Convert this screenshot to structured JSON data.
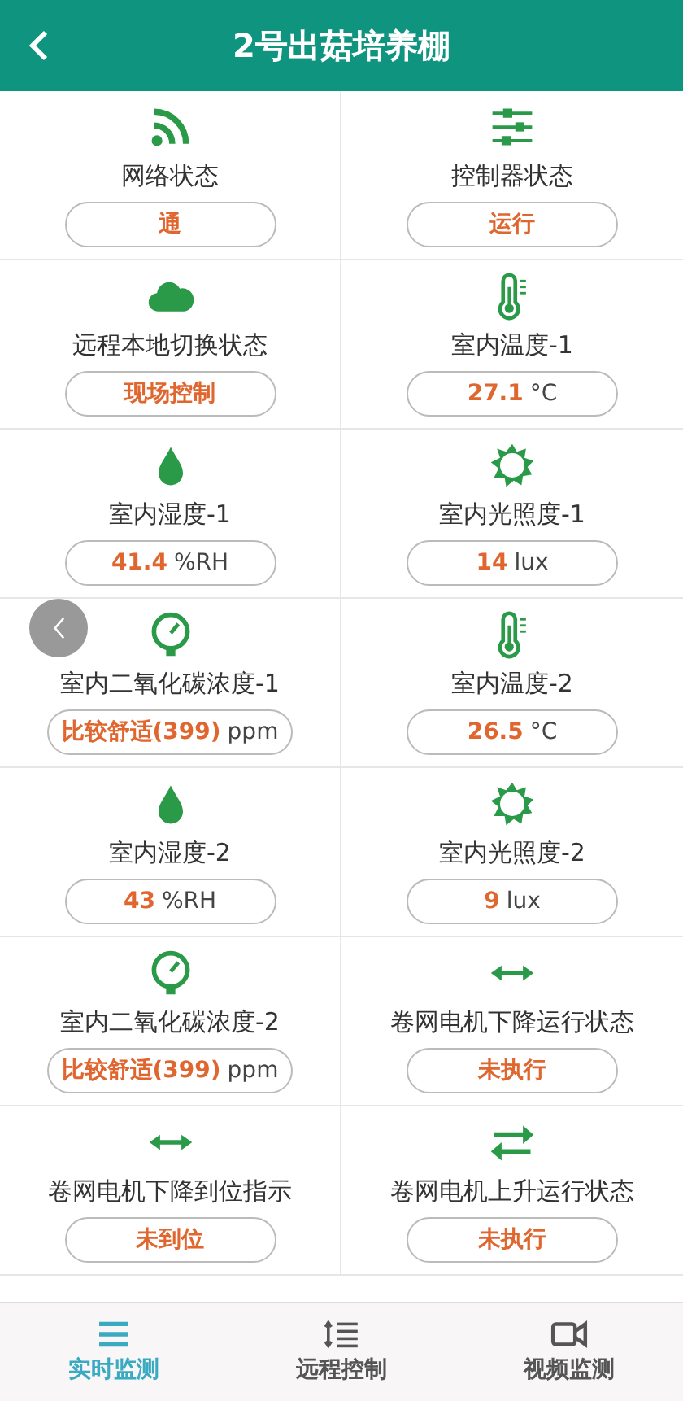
{
  "header": {
    "title": "2号出菇培养棚"
  },
  "sensors": [
    {
      "kind": "wifi",
      "label": "网络状态",
      "value": "通"
    },
    {
      "kind": "sliders",
      "label": "控制器状态",
      "value": "运行"
    },
    {
      "kind": "cloud",
      "label": "远程本地切换状态",
      "value": "现场控制"
    },
    {
      "kind": "thermometer",
      "label": "室内温度-1",
      "value": "27.1",
      "unit": "°C"
    },
    {
      "kind": "drop",
      "label": "室内湿度-1",
      "value": "41.4",
      "unit": "%RH"
    },
    {
      "kind": "sun",
      "label": "室内光照度-1",
      "value": "14",
      "unit": "lux"
    },
    {
      "kind": "gauge",
      "label": "室内二氧化碳浓度-1",
      "value": "比较舒适(399)",
      "unit": "ppm"
    },
    {
      "kind": "thermometer",
      "label": "室内温度-2",
      "value": "26.5",
      "unit": "°C"
    },
    {
      "kind": "drop",
      "label": "室内湿度-2",
      "value": "43",
      "unit": "%RH"
    },
    {
      "kind": "sun",
      "label": "室内光照度-2",
      "value": "9",
      "unit": "lux"
    },
    {
      "kind": "gauge",
      "label": "室内二氧化碳浓度-2",
      "value": "比较舒适(399)",
      "unit": "ppm"
    },
    {
      "kind": "double-arrow",
      "label": "卷网电机下降运行状态",
      "value": "未执行"
    },
    {
      "kind": "double-arrow",
      "label": "卷网电机下降到位指示",
      "value": "未到位"
    },
    {
      "kind": "exchange",
      "label": "卷网电机上升运行状态",
      "value": "未执行"
    }
  ],
  "tabs": [
    {
      "kind": "list",
      "label": "实时监测",
      "selected": true
    },
    {
      "kind": "sort",
      "label": "远程控制",
      "selected": false
    },
    {
      "kind": "video",
      "label": "视频监测",
      "selected": false
    }
  ]
}
